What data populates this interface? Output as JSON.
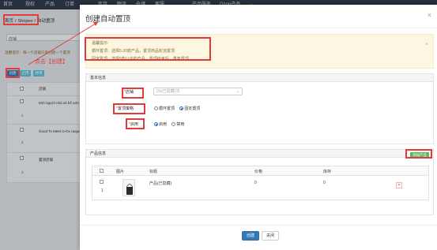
{
  "nav": {
    "items": [
      "首页",
      "授权",
      "产品",
      "订单",
      "库存",
      "物流",
      "仓储",
      "客服",
      "产品服务",
      "Ozon产品"
    ]
  },
  "background": {
    "breadcrumb": [
      "首页",
      "Shopee",
      "自动置顶"
    ],
    "shop_select": "店铺",
    "notice": "温馨提示：每一个店铺只能创建一个置顶",
    "buttons": [
      "创建",
      "启用",
      "停用"
    ],
    "click_hint": "点击【创建】",
    "rows": [
      {
        "index": "",
        "text": "店铺"
      },
      {
        "index": "1",
        "text": "Mới người nhà và bố anh"
      },
      {
        "index": "2",
        "text": "Good To Meet U-Ox raquete"
      },
      {
        "index": "3",
        "text": "置顶店铺"
      }
    ]
  },
  "modal": {
    "title": "创建自动置顶",
    "close": "×",
    "tips": {
      "heading": "温馨提示:",
      "line1": "循环置顶：选择5-20款产品，置顶商品轮流置顶",
      "line2": "固定置顶：选择5款以内的产品，置顶结束后，重复置顶",
      "close": "×"
    },
    "basic": {
      "heading": "基本信息",
      "shop_label": "店铺",
      "shop_value": "Dx(已隐藏)法",
      "strategy_label": "置顶策略",
      "strategy_options": [
        "循环置顶",
        "固定置顶"
      ],
      "strategy_selected": "固定置顶",
      "enable_label": "启用",
      "enable_options": [
        "启用",
        "禁用"
      ],
      "enable_selected": "启用"
    },
    "products": {
      "heading": "产品信息",
      "add_button": "添加产品",
      "columns": [
        "图片",
        "标题",
        "价格",
        "库存"
      ],
      "rows": [
        {
          "index": "1",
          "title": "产品(已隐藏)",
          "price": "0",
          "stock": "0"
        }
      ]
    },
    "footer": {
      "create": "创建",
      "close": "关闭"
    }
  },
  "colors": {
    "primary": "#337ab7",
    "success": "#5cb85c",
    "danger": "#d9534f",
    "annotation": "#e23b3b",
    "warning_bg": "#fdf6e0"
  }
}
